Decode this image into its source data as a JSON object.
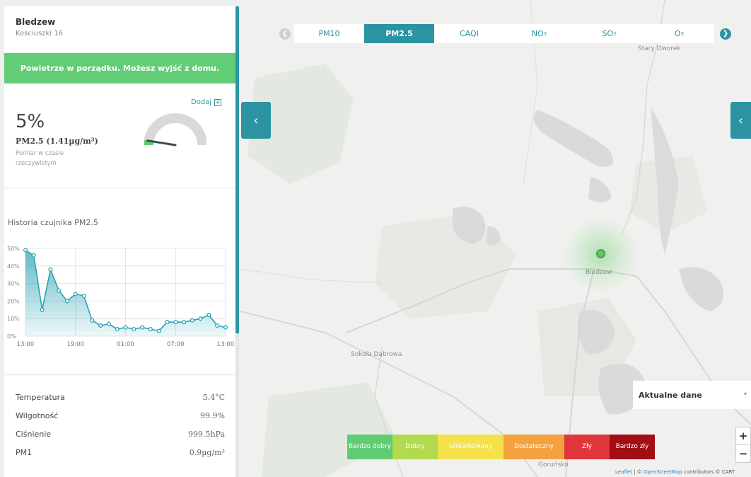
{
  "station": {
    "name": "Bledzew",
    "address": "Kościuszki 16",
    "status_message": "Powietrze w porządku. Możesz wyjść z domu.",
    "add_label": "Dodaj"
  },
  "reading": {
    "percent": "5%",
    "pollutant_value": "PM2.5 (1.41µg/m³)",
    "note": "Pomiar w czasie rzeczywistym",
    "gauge_level": 0.05
  },
  "history": {
    "title": "Historia czujnika PM2.5"
  },
  "chart_data": {
    "type": "area",
    "title": "Historia czujnika PM2.5",
    "xticks": [
      "13:00",
      "19:00",
      "01:00",
      "07:00",
      "13:00"
    ],
    "yticks": [
      "0%",
      "10%",
      "20%",
      "30%",
      "40%",
      "50%"
    ],
    "ylim": [
      0,
      50
    ],
    "grid": true,
    "series": [
      {
        "values": [
          49,
          46,
          15,
          38,
          26,
          20,
          24,
          23,
          9,
          6,
          7,
          4,
          5,
          4,
          5,
          4,
          3,
          8,
          8,
          8,
          9,
          10,
          12,
          6,
          5
        ]
      }
    ]
  },
  "stats": [
    {
      "label": "Temperatura",
      "value": "5.4°C"
    },
    {
      "label": "Wilgotność",
      "value": "99.9%"
    },
    {
      "label": "Ciśnienie",
      "value": "999.5hPa"
    },
    {
      "label": "PM1",
      "value": "0.9µg/m³"
    }
  ],
  "tabs": {
    "items": [
      {
        "label": "PM10",
        "sub": ""
      },
      {
        "label": "PM2.5",
        "sub": ""
      },
      {
        "label": "CAQI",
        "sub": ""
      },
      {
        "label": "NO",
        "sub": "2"
      },
      {
        "label": "SO",
        "sub": "2"
      },
      {
        "label": "O",
        "sub": "3"
      }
    ],
    "active_index": 1
  },
  "map": {
    "places": {
      "stary_dworek": "Stary Dworek",
      "bledzew": "Bledzew",
      "sokola": "Sokola Dąbrowa",
      "goruńsko": "Goruńsko"
    },
    "data_select": "Aktualne dane",
    "zoom_in": "+",
    "zoom_out": "−",
    "attribution_leaflet": "Leaflet",
    "attribution_sep": " | © ",
    "attribution_osm": "OpenStreetMap",
    "attribution_tail": " contributors © CART"
  },
  "legend": [
    {
      "label": "Bardzo dobry",
      "color": "#5fcc73"
    },
    {
      "label": "Dobry",
      "color": "#b3d94f"
    },
    {
      "label": "Umiarkowany",
      "color": "#f4e14b"
    },
    {
      "label": "Dostateczny",
      "color": "#f3a23f"
    },
    {
      "label": "Zły",
      "color": "#e0373c"
    },
    {
      "label": "Bardzo zły",
      "color": "#a10f14"
    }
  ],
  "colors": {
    "accent": "#2b93a2",
    "status_good": "#63cc76",
    "chart_line": "#2aa3b5"
  }
}
